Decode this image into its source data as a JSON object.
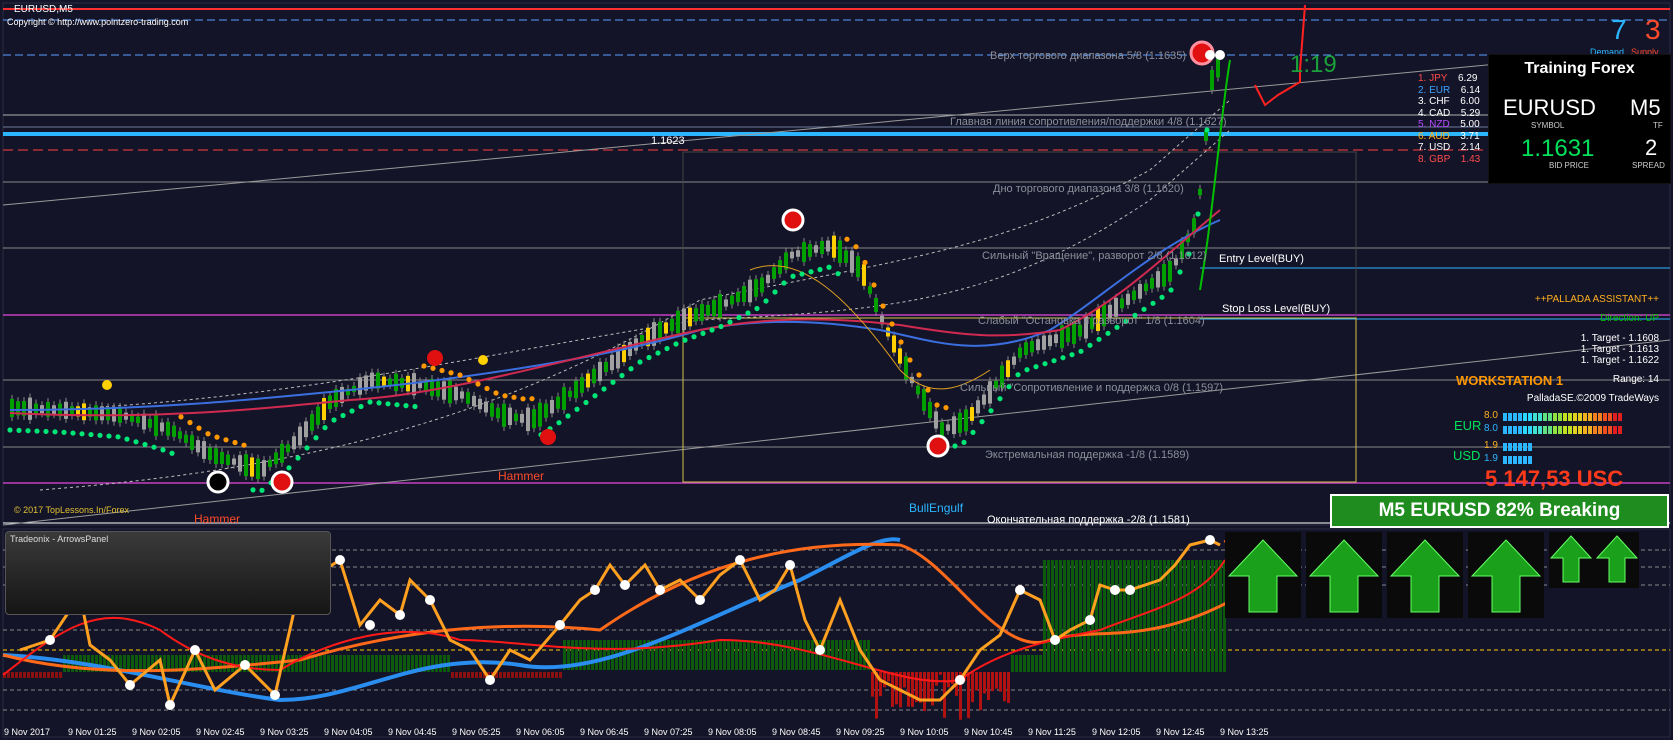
{
  "window": {
    "title": "EURUSD,M5",
    "copyright": "Copyright © http://www.pointzero-trading.com",
    "toplessons": "© 2017 TopLessons.In/Forex"
  },
  "corner_numbers": {
    "left": "7",
    "right": "3"
  },
  "demand_supply": {
    "demand": "Demand",
    "supply": "Supply"
  },
  "timer": "1:19",
  "price_marker": "1.1623",
  "levels": [
    "Верх торгового диапазона 5/8  (1.1635)",
    "Главная линия сопротивления/поддержки 4/8  (1.1627)",
    "Дно торгового диапазона 3/8  (1.1620)",
    "Сильный \"Вращение\", разворот 2/8  (1.1612)",
    "Слабый \"Остановка и разворот\" 1/8  (1.1604)",
    "Сильный \"Сопротивление и поддержка 0/8  (1.1597)",
    "Экстремальная поддержка -1/8  (1.1589)",
    "Окончательная поддержка -2/8  (1.1581)"
  ],
  "entry_level": "Entry Level(BUY)",
  "stop_loss_level": "Stop Loss Level(BUY)",
  "patterns": {
    "hammer1": "Hammer",
    "hammer2": "Hammer",
    "bullengulf": "BullEngulf"
  },
  "currency_strength": [
    {
      "rank": "1.",
      "cur": "JPY",
      "val": "6.29",
      "color": "#ff4b4b"
    },
    {
      "rank": "2.",
      "cur": "EUR",
      "val": "6.14",
      "color": "#3aa0ff"
    },
    {
      "rank": "3.",
      "cur": "CHF",
      "val": "6.00",
      "color": "#ffffff"
    },
    {
      "rank": "4.",
      "cur": "CAD",
      "val": "5.29",
      "color": "#ffffff"
    },
    {
      "rank": "5.",
      "cur": "NZD",
      "val": "5.00",
      "color": "#b44bff"
    },
    {
      "rank": "6.",
      "cur": "AUD",
      "val": "3.71",
      "color": "#ffb020"
    },
    {
      "rank": "7.",
      "cur": "USD",
      "val": "2.14",
      "color": "#ffffff"
    },
    {
      "rank": "8.",
      "cur": "GBP",
      "val": "1.43",
      "color": "#ff4b4b"
    }
  ],
  "training_forex": {
    "title": "Training Forex",
    "symbol": "EURUSD",
    "symbol_label": "SYMBOL",
    "tf": "M5",
    "tf_label": "TF",
    "bid": "1.1631",
    "bid_label": "BID PRICE",
    "spread": "2",
    "spread_label": "SPREAD"
  },
  "pallada": {
    "title": "++PALLADA ASSISTANT++",
    "direction": "Direction: UP",
    "target1": "1. Target - 1.1608",
    "target2": "1. Target - 1.1613",
    "target3": "1. Target - 1.1622",
    "range": "Range: 14",
    "workstation": "WORKSTATION 1",
    "credit": "PalladaSE.©2009 TradeWays"
  },
  "meters": {
    "eur_label": "EUR",
    "eur_v1": "8.0",
    "eur_v2": "8.0",
    "usd_label": "USD",
    "usd_v1": "1.9",
    "usd_v2": "1.9"
  },
  "balance": "5 147,53 USC",
  "breaking": "M5 EURUSD  82% Breaking",
  "arrows_panel": {
    "title": "Tradeonix - ArrowsPanel"
  },
  "time_axis": [
    "9 Nov 2017",
    "9 Nov 01:25",
    "9 Nov 02:05",
    "9 Nov 02:45",
    "9 Nov 03:25",
    "9 Nov 04:05",
    "9 Nov 04:45",
    "9 Nov 05:25",
    "9 Nov 06:05",
    "9 Nov 06:45",
    "9 Nov 07:25",
    "9 Nov 08:05",
    "9 Nov 08:45",
    "9 Nov 09:25",
    "9 Nov 10:05",
    "9 Nov 10:45",
    "9 Nov 11:25",
    "9 Nov 12:05",
    "9 Nov 12:45",
    "9 Nov 13:25"
  ],
  "colors": {
    "bull": "#00a000",
    "bear": "#a0a0a0",
    "signal": "#ffd000",
    "up_trend": "#ff2020",
    "ema": "#3b82f6",
    "dots_up": "#00e676",
    "dots_down": "#ff9800"
  }
}
